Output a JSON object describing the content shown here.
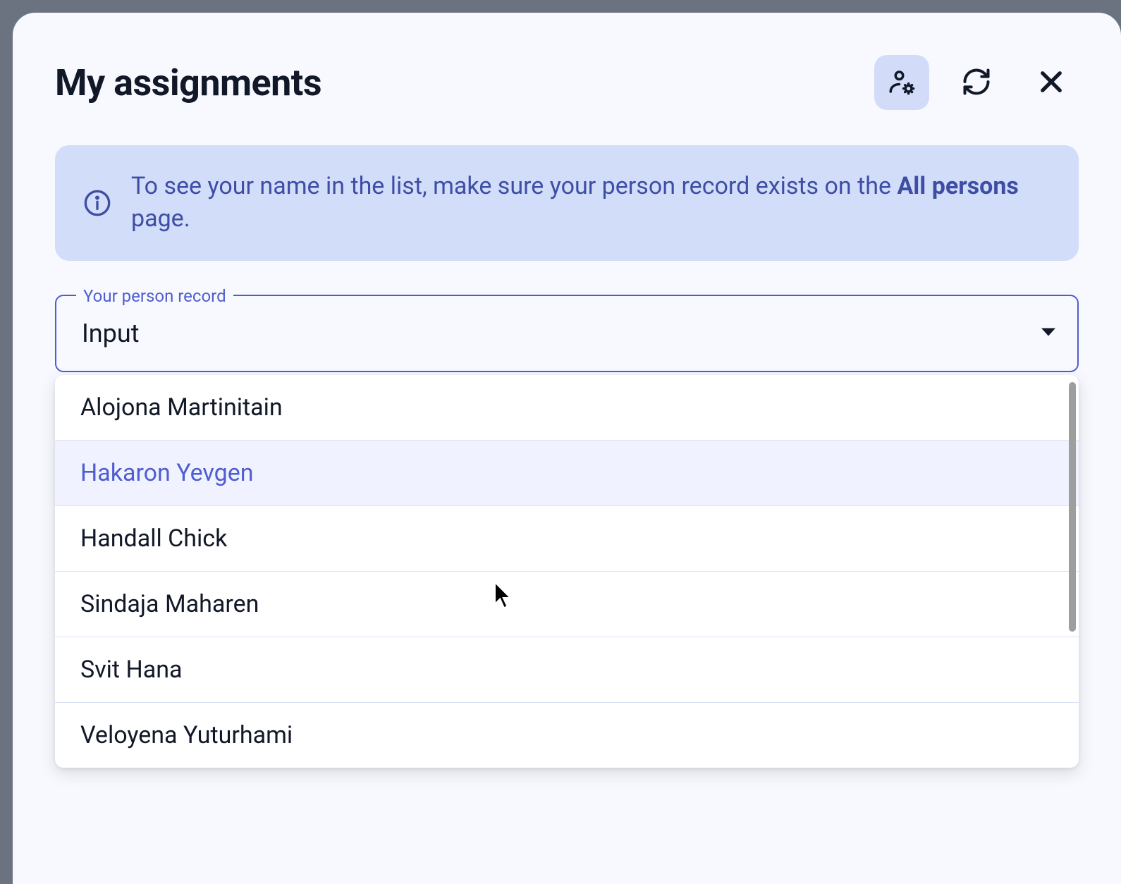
{
  "dialog": {
    "title": "My assignments"
  },
  "banner": {
    "text_prefix": "To see your name in the list, make sure your person record exists on the ",
    "text_bold": "All persons",
    "text_suffix": " page."
  },
  "field": {
    "label": "Your person record",
    "value": "Input"
  },
  "dropdown": {
    "options": [
      {
        "label": "Alojona Martinitain",
        "selected": false
      },
      {
        "label": "Hakaron Yevgen",
        "selected": true
      },
      {
        "label": "Handall Chick",
        "selected": false
      },
      {
        "label": "Sindaja Maharen",
        "selected": false
      },
      {
        "label": "Svit Hana",
        "selected": false
      },
      {
        "label": "Veloyena Yuturhami",
        "selected": false
      }
    ]
  },
  "bg_hint": "s"
}
